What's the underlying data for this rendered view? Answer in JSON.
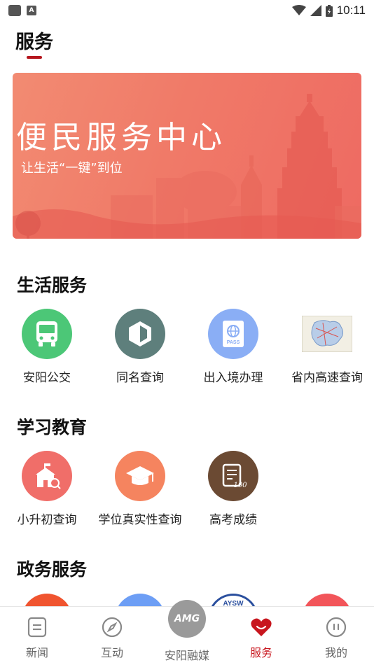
{
  "status_bar": {
    "time": "10:11",
    "a_label": "A"
  },
  "header": {
    "title": "服务"
  },
  "banner": {
    "title": "便民服务中心",
    "subtitle": "让生活“一键”到位"
  },
  "sections": {
    "life": {
      "title": "生活服务",
      "items": [
        {
          "label": "安阳公交",
          "icon": "bus-icon",
          "color": "#4cc777"
        },
        {
          "label": "同名查询",
          "icon": "shield-icon",
          "color": "#5e7f7c"
        },
        {
          "label": "出入境办理",
          "icon": "passport-icon",
          "color": "#8aaef5"
        },
        {
          "label": "省内高速查询",
          "icon": "map-icon",
          "color": "#f2efe4"
        }
      ]
    },
    "education": {
      "title": "学习教育",
      "items": [
        {
          "label": "小升初查询",
          "icon": "school-icon",
          "color": "#f06e69"
        },
        {
          "label": "学位真实性查询",
          "icon": "graduation-cap-icon",
          "color": "#f5845f"
        },
        {
          "label": "高考成绩",
          "icon": "score-sheet-icon",
          "color": "#6b4a33"
        }
      ]
    },
    "government": {
      "title": "政务服务",
      "peek_badge": "AYSW"
    }
  },
  "bottom_nav": {
    "items": [
      {
        "label": "新闻",
        "icon": "news-icon"
      },
      {
        "label": "互动",
        "icon": "compass-icon"
      },
      {
        "label": "安阳融媒",
        "icon": "amg-logo"
      },
      {
        "label": "服务",
        "icon": "heart-icon"
      },
      {
        "label": "我的",
        "icon": "profile-icon"
      }
    ],
    "center_logo_text": "AMG",
    "active_color": "#c8161e"
  }
}
